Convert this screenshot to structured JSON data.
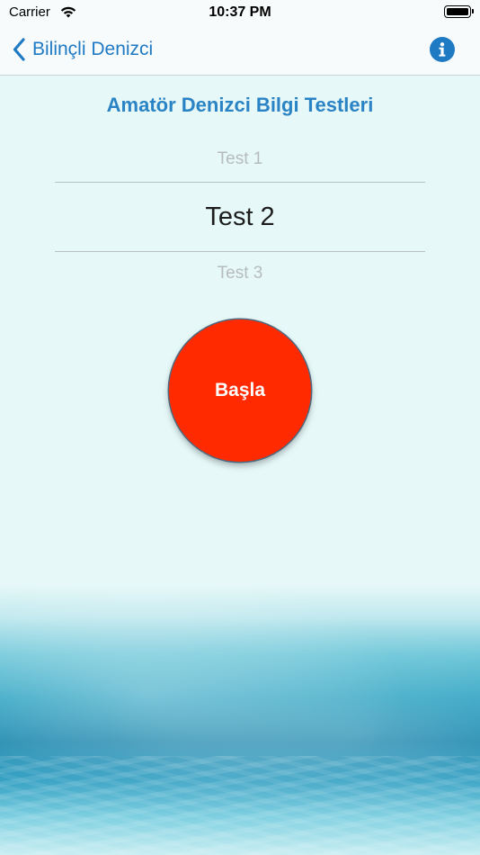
{
  "status_bar": {
    "carrier": "Carrier",
    "time": "10:37 PM"
  },
  "nav": {
    "back_label": "Bilinçli Denizci",
    "accent_color": "#1f7ac4"
  },
  "main": {
    "title": "Amatör Denizci Bilgi Testleri",
    "picker": {
      "options": [
        "Test 1",
        "Test 2",
        "Test 3"
      ],
      "selected": "Test 2"
    },
    "start_button": {
      "label": "Başla",
      "color": "#ff2a00"
    }
  },
  "icons": {
    "back": "chevron-left-icon",
    "info": "info-icon",
    "wifi": "wifi-icon",
    "battery": "battery-icon"
  }
}
